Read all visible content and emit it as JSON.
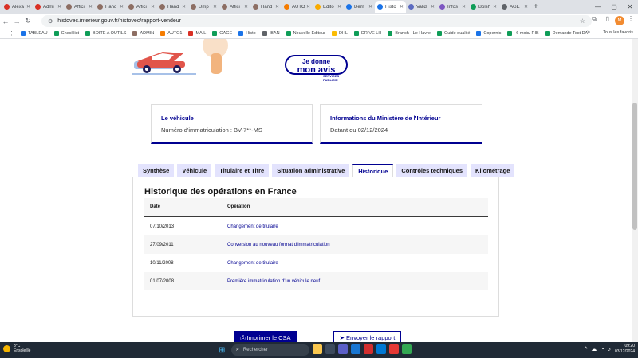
{
  "browser": {
    "tabs": [
      {
        "title": "Alexa",
        "color": "#d93025"
      },
      {
        "title": "Admi",
        "color": "#d93025"
      },
      {
        "title": "Affici",
        "color": "#8d6e63"
      },
      {
        "title": "Hand",
        "color": "#8d6e63"
      },
      {
        "title": "Affici",
        "color": "#8d6e63"
      },
      {
        "title": "Hand",
        "color": "#8d6e63"
      },
      {
        "title": "Ump",
        "color": "#8d6e63"
      },
      {
        "title": "Affici",
        "color": "#8d6e63"
      },
      {
        "title": "Hand",
        "color": "#8d6e63"
      },
      {
        "title": "AUTO",
        "color": "#f57c00"
      },
      {
        "title": "Edito",
        "color": "#f9ab00"
      },
      {
        "title": "Dem",
        "color": "#1a73e8"
      },
      {
        "title": "Histo",
        "color": "#1a73e8",
        "active": true
      },
      {
        "title": "Valid",
        "color": "#5c6bc0"
      },
      {
        "title": "Infos",
        "color": "#7e57c2"
      },
      {
        "title": "Bolsh",
        "color": "#0f9d58"
      },
      {
        "title": "AGE",
        "color": "#5f6368"
      }
    ],
    "new_tab": "+",
    "url": "histovec.interieur.gouv.fr/histovec/rapport-vendeur",
    "profile_initial": "M",
    "bookmarks": [
      {
        "label": "TABLEAU",
        "color": "#1a73e8"
      },
      {
        "label": "Checklist",
        "color": "#0f9d58"
      },
      {
        "label": "BOITE A OUTILS",
        "color": "#0f9d58"
      },
      {
        "label": "ADMIN",
        "color": "#8d6e63"
      },
      {
        "label": "AUTO1",
        "color": "#f57c00"
      },
      {
        "label": "MAIL",
        "color": "#d93025"
      },
      {
        "label": "GAGE",
        "color": "#0f9d58"
      },
      {
        "label": "Histo",
        "color": "#1a73e8"
      },
      {
        "label": "IBAN",
        "color": "#5f6368"
      },
      {
        "label": "Nouvelle Editeur",
        "color": "#0f9d58"
      },
      {
        "label": "DHL",
        "color": "#fbbc04"
      },
      {
        "label": "DRIVE LH",
        "color": "#0f9d58"
      },
      {
        "label": "Branch - Le Havre",
        "color": "#0f9d58"
      },
      {
        "label": "Guide qualité",
        "color": "#0f9d58"
      },
      {
        "label": "Copernic",
        "color": "#1a73e8"
      },
      {
        "label": "-6 mois/ RIB",
        "color": "#0f9d58"
      },
      {
        "label": "Demande Test DA",
        "color": "#0f9d58"
      }
    ],
    "all_bookmarks": "Tous les favoris"
  },
  "page": {
    "feedback": {
      "line1": "Je donne",
      "line2": "mon avis",
      "logo_line1": "SERVICES",
      "logo_line2": "PUBLICS+"
    },
    "vehicle_card": {
      "title": "Le véhicule",
      "text": "Numéro d'immatriculation : BV-7**-MS"
    },
    "ministry_card": {
      "title": "Informations du Ministère de l'Intérieur",
      "text": "Datant du 02/12/2024"
    },
    "tabs": [
      {
        "label": "Synthèse"
      },
      {
        "label": "Véhicule"
      },
      {
        "label": "Titulaire et Titre"
      },
      {
        "label": "Situation administrative"
      },
      {
        "label": "Historique",
        "active": true
      },
      {
        "label": "Contrôles techniques"
      },
      {
        "label": "Kilométrage"
      }
    ],
    "history": {
      "title": "Historique des opérations en France",
      "col_date": "Date",
      "col_op": "Opération",
      "rows": [
        {
          "date": "07/10/2013",
          "op": "Changement de titulaire"
        },
        {
          "date": "27/09/2011",
          "op": "Conversion au nouveau format d'immatriculation"
        },
        {
          "date": "10/11/2008",
          "op": "Changement de titulaire"
        },
        {
          "date": "01/07/2008",
          "op": "Première immatriculation d'un véhicule neuf"
        }
      ]
    },
    "print_button": "Imprimer le CSA",
    "send_button": "Envoyer le rapport"
  },
  "taskbar": {
    "temperature": "3°C",
    "weather": "Ensoleillé",
    "search_placeholder": "Rechercher",
    "time": "09:20",
    "date": "03/12/2024"
  }
}
